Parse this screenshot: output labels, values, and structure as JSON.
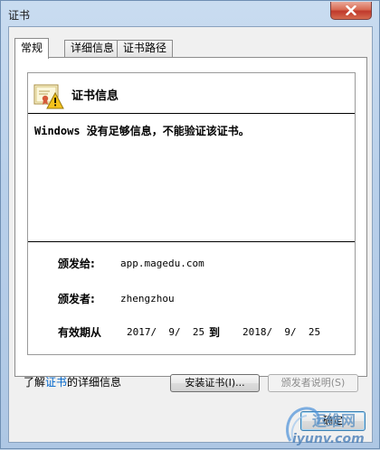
{
  "window": {
    "title": "证书"
  },
  "tabs": [
    {
      "label": "常规"
    },
    {
      "label": "详细信息"
    },
    {
      "label": "证书路径"
    }
  ],
  "cert": {
    "heading": "证书信息",
    "warning": "Windows 没有足够信息，不能验证该证书。",
    "issued_to_label": "颁发给:",
    "issued_to_value": "app.magedu.com",
    "issued_by_label": "颁发者:",
    "issued_by_value": "zhengzhou",
    "valid_label": "有效期从",
    "valid_from": "2017/  9/  25",
    "valid_to_word": "到",
    "valid_to": "2018/  9/  25"
  },
  "buttons": {
    "install": "安装证书(I)...",
    "issuer_statement": "颁发者说明(S)",
    "ok": "确定"
  },
  "details": {
    "prefix": "了解",
    "link": "证书",
    "suffix": "的详细信息"
  },
  "watermark": {
    "main": "运维网",
    "sub": "iyunv.com"
  },
  "colors": {
    "link": "#0066cc",
    "close_button": "#c0392b",
    "title_bar": "#c9dcf0"
  }
}
